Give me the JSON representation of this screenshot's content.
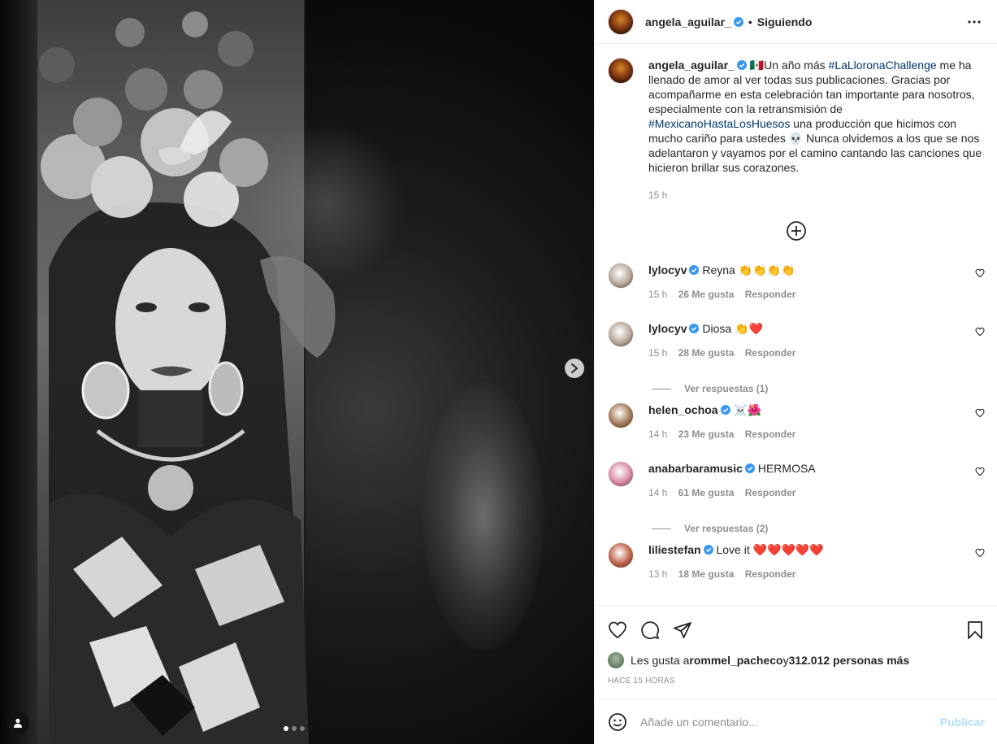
{
  "header": {
    "username": "angela_aguilar_",
    "follow_status": "Siguiendo",
    "dot": "•"
  },
  "caption": {
    "username": "angela_aguilar_",
    "text_1": "🇲🇽Un año más ",
    "hashtag_1": "#LaLloronaChallenge",
    "text_2": " me ha llenado de amor al ver todas sus publicaciones. Gracias por acompañarme en esta celebración tan importante para nosotros, especialmente con la retransmisión de ",
    "hashtag_2": "#MexicanoHastaLosHuesos",
    "text_3": " una producción que hicimos con mucho cariño para ustedes 💀 Nunca olvidemos a los que se nos adelantaron y vayamos por el camino cantando las canciones que hicieron brillar sus corazones.",
    "time": "15 h"
  },
  "comments": [
    {
      "username": "lylocyv",
      "text": "Reyna 👏👏👏👏",
      "time": "15 h",
      "likes": "26 Me gusta",
      "reply": "Responder",
      "avatar_color": "#b9a89a",
      "view_replies": ""
    },
    {
      "username": "lylocyv",
      "text": "Diosa 👏❤️",
      "time": "15 h",
      "likes": "28 Me gusta",
      "reply": "Responder",
      "avatar_color": "#b9a89a",
      "view_replies": "Ver respuestas (1)"
    },
    {
      "username": "helen_ochoa",
      "text": "☠️🌺",
      "time": "14 h",
      "likes": "23 Me gusta",
      "reply": "Responder",
      "avatar_color": "#a57a56",
      "view_replies": ""
    },
    {
      "username": "anabarbaramusic",
      "text": "HERMOSA",
      "time": "14 h",
      "likes": "61 Me gusta",
      "reply": "Responder",
      "avatar_color": "#d98aa5",
      "view_replies": "Ver respuestas (2)"
    },
    {
      "username": "liliestefan",
      "text": "Love it ❤️❤️❤️❤️❤️",
      "time": "13 h",
      "likes": "18 Me gusta",
      "reply": "Responder",
      "avatar_color": "#c0624a",
      "view_replies": ""
    }
  ],
  "likes": {
    "prefix": "Les gusta a ",
    "user": "rommel_pacheco",
    "mid": " y ",
    "count": "312.012 personas más"
  },
  "posted_ago": "HACE 15 HORAS",
  "add_comment": {
    "placeholder": "Añade un comentario...",
    "post_label": "Publicar"
  },
  "colors": {
    "verified": "#3897f0",
    "hashtag": "#00376b",
    "muted": "#8e8e8e",
    "post_disabled": "#b2dffc"
  },
  "carousel": {
    "slides": 3,
    "active": 1
  }
}
